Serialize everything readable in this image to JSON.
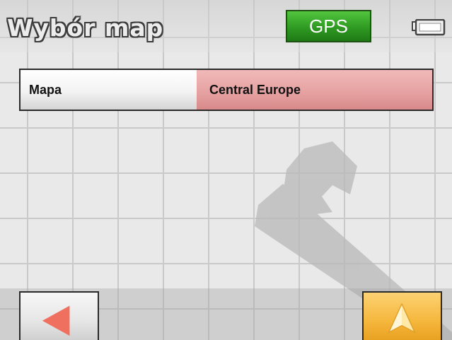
{
  "header": {
    "title": "Wybór map",
    "gps_label": "GPS",
    "battery_icon": "battery-icon"
  },
  "settings": {
    "map_row": {
      "label": "Mapa",
      "value": "Central Europe"
    }
  },
  "footer": {
    "back_icon": "back-arrow-icon",
    "navigate_icon": "navigation-arrow-icon"
  },
  "background": {
    "watermark_icon": "wrench-icon"
  },
  "colors": {
    "gps_green": "#2f9a22",
    "value_cell_red": "#e5a0a0",
    "nav_button_orange": "#f5b73d",
    "back_arrow_red": "#f07060"
  }
}
